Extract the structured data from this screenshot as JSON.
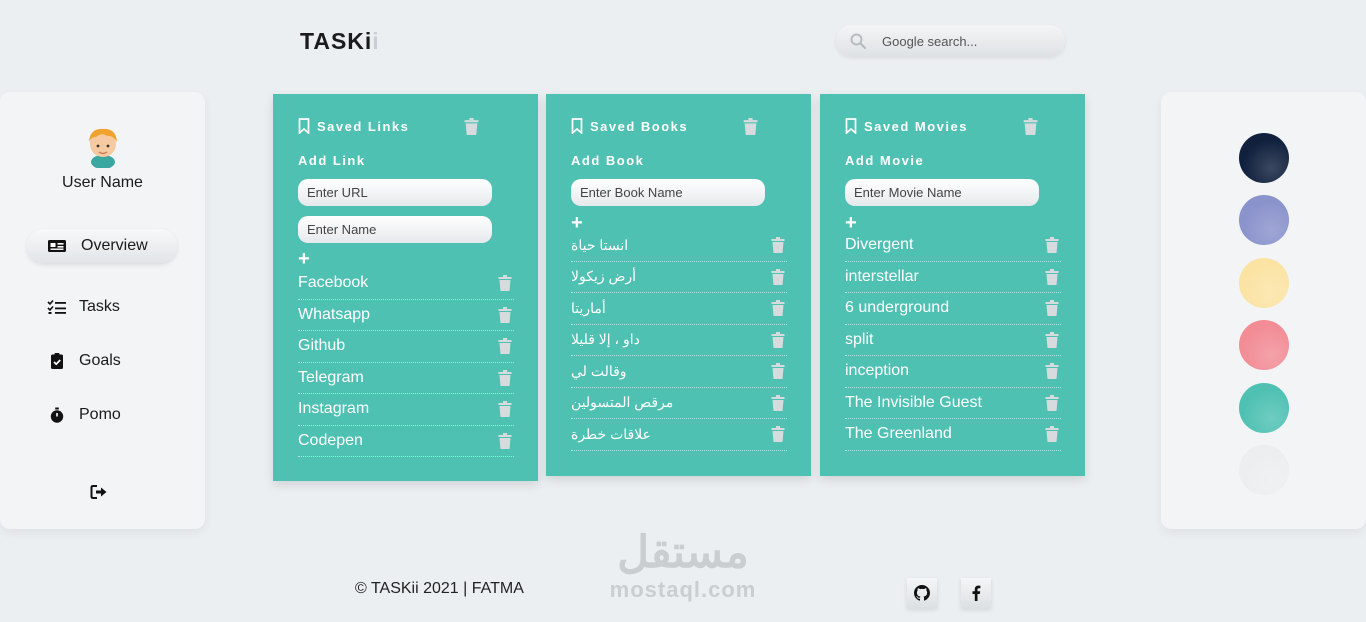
{
  "header": {
    "logo_main": "TASKi",
    "logo_faded": "i",
    "search_placeholder": "Google search..."
  },
  "sidebar": {
    "username": "User Name",
    "nav": [
      {
        "label": "Overview",
        "icon": "id-card-icon",
        "active": true
      },
      {
        "label": "Tasks",
        "icon": "tasks-list-icon",
        "active": false
      },
      {
        "label": "Goals",
        "icon": "clipboard-check-icon",
        "active": false
      },
      {
        "label": "Pomo",
        "icon": "stopwatch-icon",
        "active": false
      }
    ],
    "logout_icon": "sign-out-icon"
  },
  "cards": {
    "links": {
      "title": "Saved Links",
      "add_label": "Add Link",
      "url_placeholder": "Enter URL",
      "name_placeholder": "Enter Name",
      "plus": "+",
      "items": [
        "Facebook",
        "Whatsapp",
        "Github",
        "Telegram",
        "Instagram",
        "Codepen"
      ]
    },
    "books": {
      "title": "Saved Books",
      "add_label": "Add Book",
      "name_placeholder": "Enter Book Name",
      "plus": "+",
      "items": [
        "انستا حياة",
        "أرض زيكولا",
        "أماريتا",
        "داو ، إلا قليلا",
        "وقالت لي",
        "مرقص المتسولين",
        "علاقات خطرة"
      ]
    },
    "movies": {
      "title": "Saved Movies",
      "add_label": "Add Movie",
      "name_placeholder": "Enter Movie Name",
      "plus": "+",
      "items": [
        "Divergent",
        "interstellar",
        "6 underground",
        "split",
        "inception",
        "The Invisible Guest",
        "The Greenland"
      ]
    }
  },
  "theme_swatches": [
    "#10203d",
    "#8a93cc",
    "#fbe3a4",
    "#f28d96",
    "#4fc1b3",
    "#eceeef"
  ],
  "footer": {
    "copyright": "© TASKii 2021 | FATMA",
    "watermark_ar": "مستقل",
    "watermark_en": "mostaql.com"
  },
  "colors": {
    "accent": "#4fc1b3",
    "background": "#eceff2"
  }
}
